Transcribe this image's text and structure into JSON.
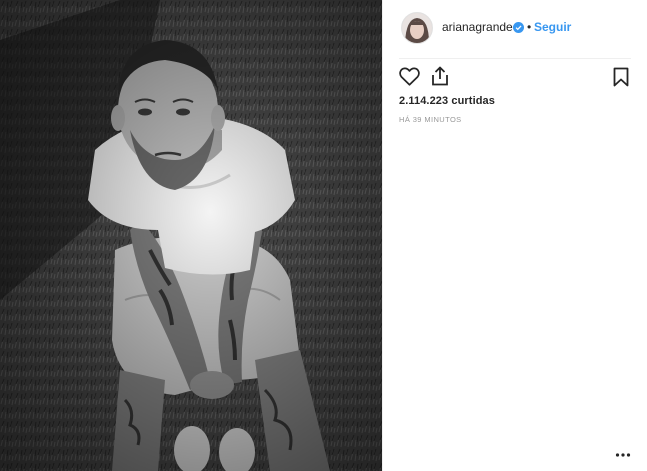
{
  "post": {
    "image_alt": "Black and white photo of a man in a white t-shirt and shorts sitting on grass",
    "username": "arianagrande",
    "verified": true,
    "separator": "•",
    "follow_label": "Seguir",
    "likes_text": "2.114.223 curtidas",
    "timestamp_text": "HÁ 39 MINUTOS"
  },
  "actions": {
    "like_icon": "heart-icon",
    "share_icon": "share-icon",
    "save_icon": "bookmark-icon",
    "more_icon": "more-options-icon"
  },
  "colors": {
    "link_blue": "#3897f0",
    "text_primary": "#262626",
    "text_muted": "#999999",
    "divider": "#efefef"
  }
}
